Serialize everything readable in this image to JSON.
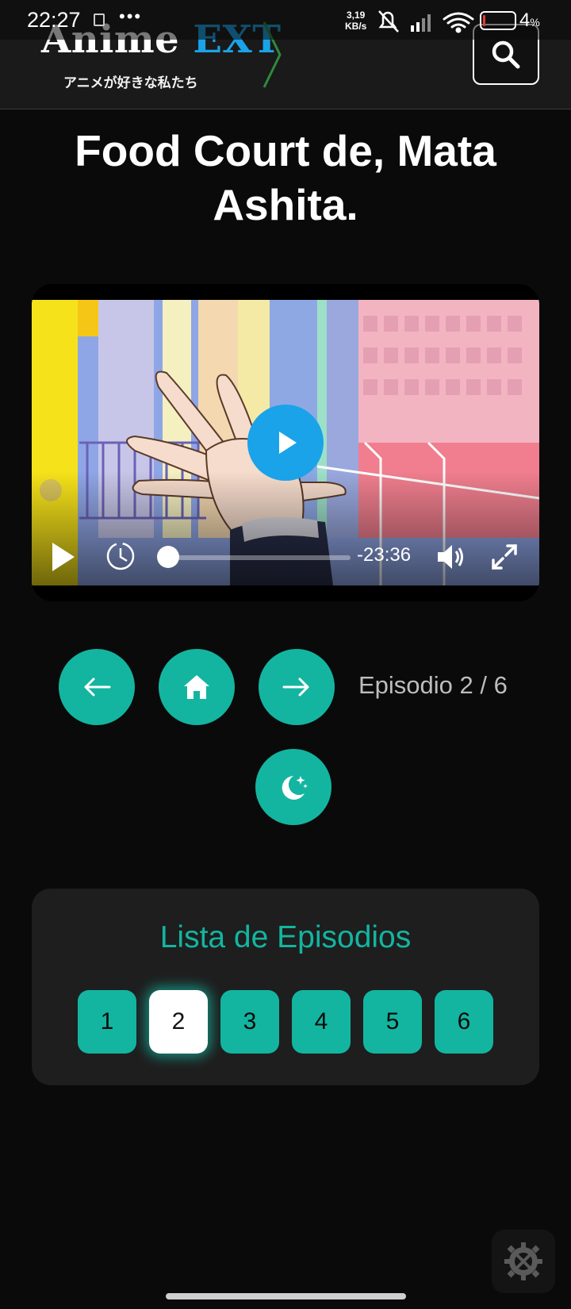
{
  "status_bar": {
    "time": "22:27",
    "dots": "•••",
    "net_speed_value": "3,19",
    "net_speed_unit": "KB/s",
    "battery_percent": "4",
    "battery_percent_sign": "%"
  },
  "header": {
    "logo_word1": "Anime",
    "logo_word2": "EXT",
    "logo_subtitle": "アニメが好きな私たち",
    "search_icon": "search-icon"
  },
  "anime": {
    "title": "Food Court de, Mata Ashita."
  },
  "player": {
    "time_remaining": "-23:36",
    "progress_fraction": 0.0,
    "icons": [
      "play-icon",
      "replay-timer-icon",
      "volume-icon",
      "fullscreen-icon"
    ]
  },
  "navigation": {
    "prev_icon": "arrow-left-icon",
    "home_icon": "home-icon",
    "next_icon": "arrow-right-icon",
    "night_mode_icon": "moon-stars-icon",
    "episode_label": "Episodio 2 / 6"
  },
  "episode_list": {
    "heading": "Lista de Episodios",
    "episodes": [
      "1",
      "2",
      "3",
      "4",
      "5",
      "6"
    ],
    "active_index": 1
  },
  "colors": {
    "accent": "#13b5a0",
    "brand_blue": "#1aa3e8",
    "background": "#0a0a0a",
    "panel": "#1e1e1e"
  },
  "settings": {
    "icon": "settings-tools-icon"
  }
}
